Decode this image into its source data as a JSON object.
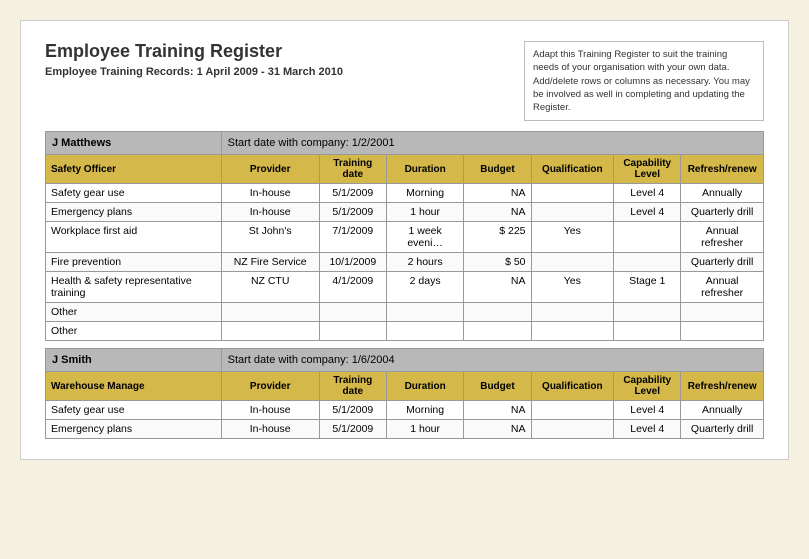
{
  "title": "Employee Training Register",
  "subtitle": "Employee Training Records: 1 April 2009 - 31 March 2010",
  "info_box": "Adapt this Training Register to suit the training needs of your organisation with your own data. Add/delete rows or columns as necessary. You may be involved as well in completing and updating the Register.",
  "columns": {
    "role": "",
    "provider": "Provider",
    "training_date": "Training date",
    "duration": "Duration",
    "budget": "Budget",
    "qualification": "Qualification",
    "capability": "Capability Level",
    "refresh": "Refresh/renew"
  },
  "employees": [
    {
      "name": "J Matthews",
      "start_label": "Start date with company:",
      "start_date": "1/2/2001",
      "role": "Safety Officer",
      "rows": [
        {
          "activity": "Safety gear use",
          "provider": "In-house",
          "date": "5/1/2009",
          "duration": "Morning",
          "budget": "NA",
          "qualification": "",
          "capability": "Level 4",
          "refresh": "Annually"
        },
        {
          "activity": "Emergency plans",
          "provider": "In-house",
          "date": "5/1/2009",
          "duration": "1 hour",
          "budget": "NA",
          "qualification": "",
          "capability": "Level 4",
          "refresh": "Quarterly drill"
        },
        {
          "activity": "Workplace first aid",
          "provider": "St John's",
          "date": "7/1/2009",
          "duration": "1 week eveni…",
          "budget": "$ 225",
          "qualification": "Yes",
          "capability": "",
          "refresh": "Annual refresher"
        },
        {
          "activity": "Fire prevention",
          "provider": "NZ Fire Service",
          "date": "10/1/2009",
          "duration": "2 hours",
          "budget": "$ 50",
          "qualification": "",
          "capability": "",
          "refresh": "Quarterly drill"
        },
        {
          "activity": "Health & safety representative training",
          "provider": "NZ CTU",
          "date": "4/1/2009",
          "duration": "2 days",
          "budget": "NA",
          "qualification": "Yes",
          "capability": "Stage 1",
          "refresh": "Annual refresher"
        },
        {
          "activity": "Other",
          "provider": "",
          "date": "",
          "duration": "",
          "budget": "",
          "qualification": "",
          "capability": "",
          "refresh": ""
        },
        {
          "activity": "Other",
          "provider": "",
          "date": "",
          "duration": "",
          "budget": "",
          "qualification": "",
          "capability": "",
          "refresh": ""
        }
      ]
    },
    {
      "name": "J Smith",
      "start_label": "Start date with company:",
      "start_date": "1/6/2004",
      "role": "Warehouse Manage",
      "rows": [
        {
          "activity": "Safety gear use",
          "provider": "In-house",
          "date": "5/1/2009",
          "duration": "Morning",
          "budget": "NA",
          "qualification": "",
          "capability": "Level 4",
          "refresh": "Annually"
        },
        {
          "activity": "Emergency plans",
          "provider": "In-house",
          "date": "5/1/2009",
          "duration": "1 hour",
          "budget": "NA",
          "qualification": "",
          "capability": "Level 4",
          "refresh": "Quarterly drill"
        }
      ]
    }
  ]
}
